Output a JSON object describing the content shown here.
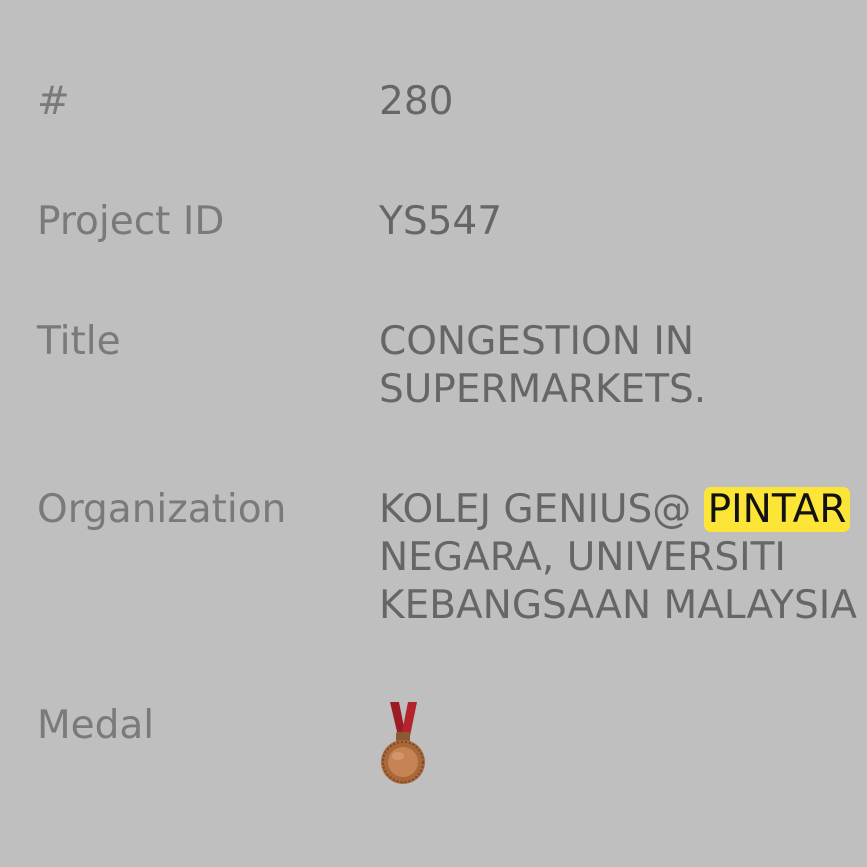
{
  "rows": [
    {
      "label": "#",
      "value": "280"
    },
    {
      "label": "Project ID",
      "value": "YS547"
    },
    {
      "label": "Title",
      "lines": [
        "CONGESTION IN",
        "SUPERMARKETS."
      ]
    },
    {
      "label": "Organization",
      "line1_prefix": "KOLEJ GENIUS@ ",
      "line1_highlight": "PINTAR",
      "lines": [
        "NEGARA, UNIVERSITI",
        "KEBANGSAAN MALAYSIA"
      ]
    },
    {
      "label": "Medal",
      "icon": "bronze-medal-icon"
    }
  ],
  "colors": {
    "background": "#bfbfbf",
    "label_text": "#7a7a7a",
    "value_text": "#666666",
    "highlight": "#fde538",
    "medal_ribbon": "#b0202a",
    "medal_bronze": "#c07a4a"
  }
}
